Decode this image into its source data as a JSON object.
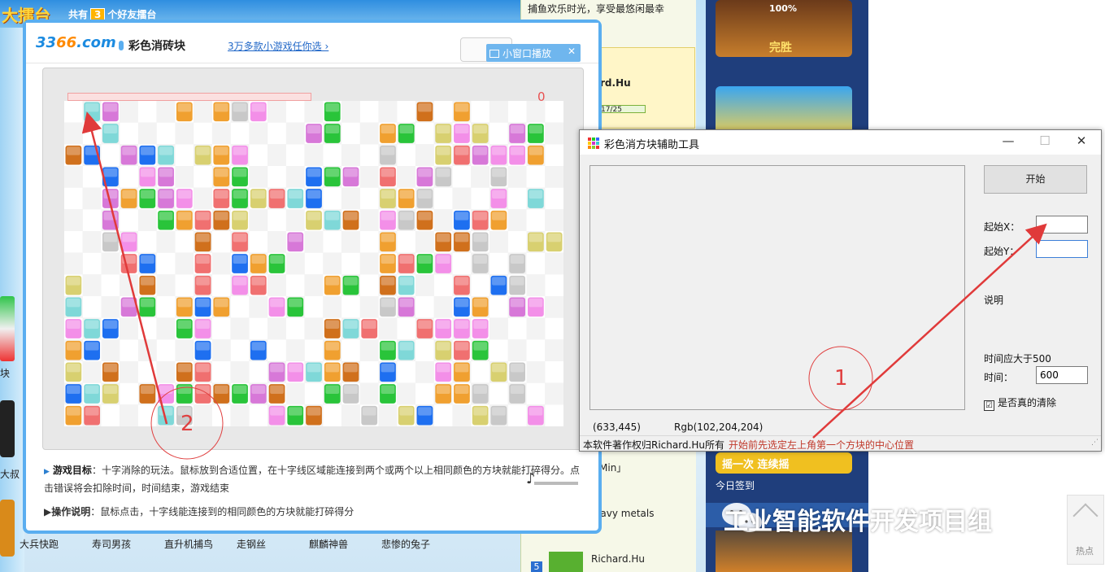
{
  "background": {
    "site_brand": "大擂台",
    "friends_prefix": "共有",
    "friends_count": "3",
    "friends_suffix": "个好友擂台",
    "side_top_text": "捕鱼欢乐时光，享受最悠闲最幸",
    "side_user1": "rd.Hu",
    "side_progress": "17/25",
    "side_min": "Min」",
    "side_metals": "eavy metals",
    "side_user2": "Richard.Hu",
    "side_rank": "5",
    "daily_sign": "今日签到",
    "shake_banner": "摇一次  连续摇",
    "promo_percent": "100%",
    "promo_win": "完胜",
    "left_edge_text": "块",
    "left_edge_text2": "大叔"
  },
  "game": {
    "logo_a": "33",
    "logo_b": "66",
    "logo_c": ".com",
    "title": "彩色消砖块",
    "more_link": "3万多款小游戏任你选 ›",
    "small_window_btn": "小窗口播放",
    "small_window_close": "✕",
    "score": "0",
    "goal_label": "游戏目标",
    "goal_text": "：十字消除的玩法。鼠标放到合适位置，在十字线区域能连接到两个或两个以上相同颜色的方块就能打碎得分。点击错误将会扣除时间，时间结束，游戏结束",
    "howto_label": "操作说明",
    "howto_text": "：鼠标点击，十字线能连接到的相同颜色的方块就能打碎得分",
    "related_games": [
      "大兵快跑",
      "寿司男孩",
      "直升机捕鸟",
      "走钢丝",
      "麒麟神兽",
      "悲惨的兔子"
    ],
    "colors": {
      "c": "#7fd8d8",
      "p": "#d778d8",
      "o": "#f0a030",
      "g": "#29c43a",
      "k": "#f38fe8",
      "r": "#f07070",
      "b": "#1e6ff0",
      "y": "#d8d070",
      "s": "#c8c8c8",
      "t": "#d0701c"
    },
    "grid": [
      ".cp...o.osk...g....t.o.....",
      "..c..........pg..og.yky.pg.",
      "tb.pbc.yok.......s..yrpkko.",
      "..b.kp..og...bgp.r.ps..s...",
      "..pogpk.rgyrcb...yos...k.c.",
      "..p..gorty...yct.kst.bro...",
      "..sk...t.r..p....o..tts..yy",
      "...rb..r.bog.....orgk.s.s..",
      "y...t..r.kr...og.tc..r.bs..",
      "c..pg.obo..kg....sp..bo.pk.",
      "kcb...gk......tcr..rkkk....",
      "ob.....b..b...o..gc.yrg....",
      "y.t...tr...pkcot.b..ko.ys..",
      "bcy.tkgrtgpt..gs.g..oos.s..",
      "or...cs....kgt..s.yb..ys.k."
    ]
  },
  "tool": {
    "window_title": "彩色消方块辅助工具",
    "minimize": "—",
    "maximize": "☐",
    "close": "✕",
    "start_button": "开始",
    "start_x_label": "起始X：",
    "start_x_value": "",
    "start_y_label": "起始Y：",
    "start_y_value": "",
    "desc_label": "说明",
    "time_hint": "时间应大于500",
    "time_label": "时间：",
    "time_value": "600",
    "really_clear_label": "是否真的清除",
    "really_clear_checked": "☑",
    "coords": "(633,445)",
    "rgb": "Rgb(102,204,204)",
    "copyright": "本软件著作权归Richard.Hu所有",
    "tip": "开始前先选定左上角第一个方块的中心位置"
  },
  "annotations": {
    "label1": "1",
    "label2": "2"
  },
  "watermark": {
    "text": "工业智能软件开发项目组",
    "hot": "热点"
  }
}
